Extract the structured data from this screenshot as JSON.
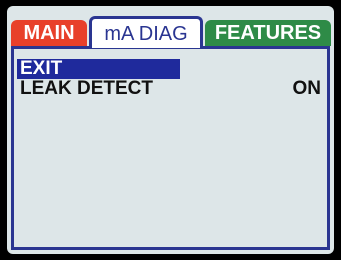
{
  "tabs": [
    {
      "label": "MAIN",
      "color": "#e8402a",
      "active": false
    },
    {
      "label": "mA DIAG",
      "color": "#2a3591",
      "active": true
    },
    {
      "label": "FEATURES",
      "color": "#2e8b47",
      "active": false
    }
  ],
  "menu": {
    "items": [
      {
        "label": "EXIT",
        "value": "",
        "selected": true
      },
      {
        "label": "LEAK DETECT",
        "value": "ON",
        "selected": false
      }
    ],
    "selection_color": "#1f2a9c"
  }
}
